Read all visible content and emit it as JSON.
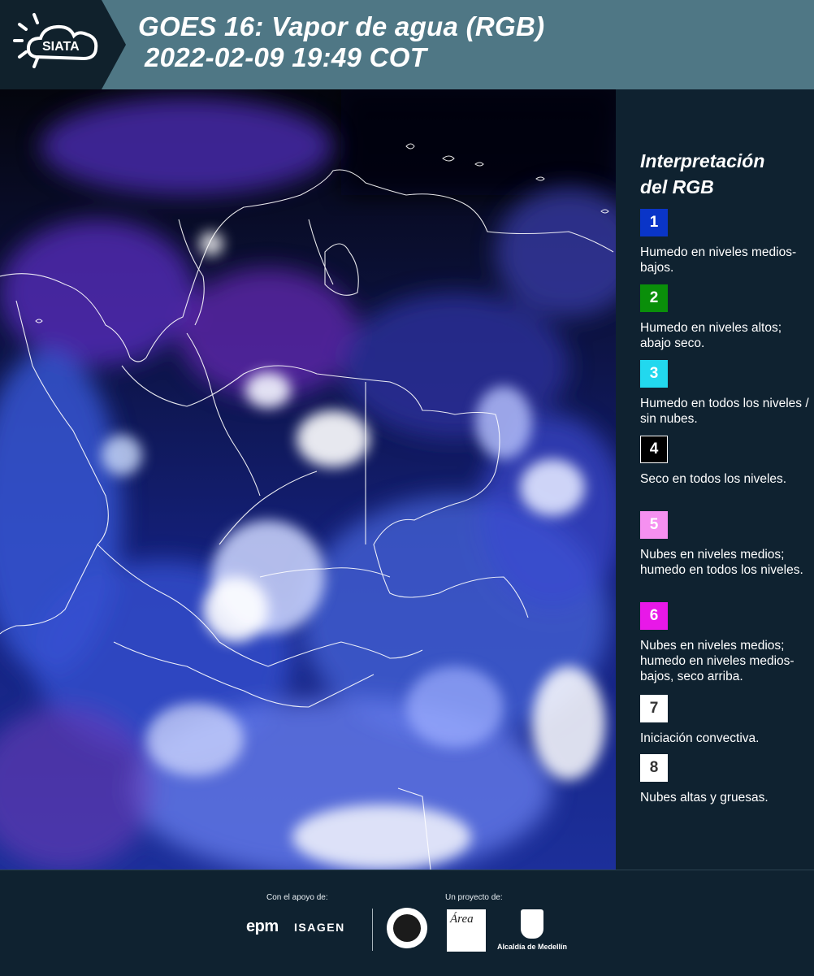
{
  "header": {
    "logo_text": "SIATA",
    "title_line1": "GOES 16: Vapor de agua (RGB)",
    "title_line2": "2022-02-09 19:49 COT"
  },
  "legend": {
    "title_line1": "Interpretación",
    "title_line2": "del RGB",
    "items": [
      {
        "number": "1",
        "color": "#0a35c8",
        "text_color": "#ffffff",
        "description": "Humedo en niveles medios-bajos."
      },
      {
        "number": "2",
        "color": "#0a8f0a",
        "text_color": "#ffffff",
        "description": "Humedo en niveles altos; abajo seco."
      },
      {
        "number": "3",
        "color": "#22d8ee",
        "text_color": "#ffffff",
        "description": "Humedo en todos los niveles / sin nubes."
      },
      {
        "number": "4",
        "color": "#000000",
        "text_color": "#ffffff",
        "description": "Seco en todos los niveles."
      },
      {
        "number": "5",
        "color": "#f590f0",
        "text_color": "#ffffff",
        "description": "Nubes en niveles medios; humedo en todos los niveles."
      },
      {
        "number": "6",
        "color": "#e818e8",
        "text_color": "#ffffff",
        "description": "Nubes en niveles medios; humedo en niveles medios-bajos, seco arriba."
      },
      {
        "number": "7",
        "color": "#ffffff",
        "text_color": "#333333",
        "description": "Iniciación convectiva."
      },
      {
        "number": "8",
        "color": "#ffffff",
        "text_color": "#333333",
        "description": "Nubes altas y gruesas."
      }
    ]
  },
  "footer": {
    "support_label": "Con el apoyo de:",
    "project_label": "Un proyecto de:",
    "sponsor1": "epm",
    "sponsor2": "ISAGEN",
    "partner_area": "Área",
    "partner_alcaldia": "Alcaldía de Medellín"
  },
  "icons": {
    "logo": "sun-cloud-icon",
    "seal": "university-seal-icon",
    "shield": "city-shield-icon"
  }
}
